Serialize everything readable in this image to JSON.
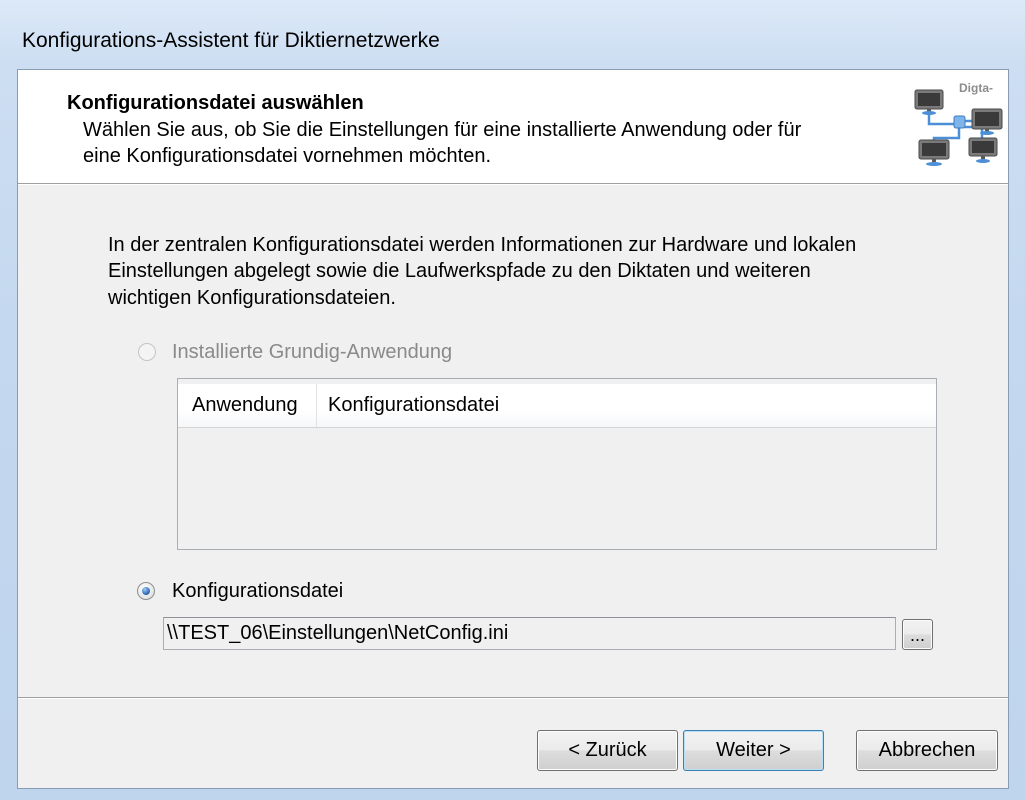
{
  "window": {
    "title": "Konfigurations-Assistent für Diktiernetzwerke"
  },
  "header": {
    "title": "Konfigurationsdatei auswählen",
    "subtitle_lines": [
      "Wählen Sie aus, ob Sie die Einstellungen für eine installierte Anwendung oder für",
      "eine Konfigurationsdatei vornehmen möchten."
    ],
    "logo_text": "Digta-",
    "logo_icon": "network-computers-icon"
  },
  "body": {
    "description_lines": [
      "In der zentralen Konfigurationsdatei werden Informationen zur Hardware und lokalen",
      "Einstellungen abgelegt sowie die Laufwerkspfade zu den Diktaten und weiteren",
      "wichtigen Konfigurationsdateien."
    ]
  },
  "options": {
    "installed_app": {
      "label": "Installierte Grundig-Anwendung",
      "selected": false,
      "enabled": false
    },
    "config_file": {
      "label": "Konfigurationsdatei",
      "selected": true,
      "enabled": true
    }
  },
  "app_list": {
    "columns": [
      "Anwendung",
      "Konfigurationsdatei"
    ],
    "rows": []
  },
  "config_path": {
    "value": "\\\\TEST_06\\Einstellungen\\NetConfig.ini",
    "browse_label": "..."
  },
  "buttons": {
    "back": "< Zurück",
    "next": "Weiter >",
    "cancel": "Abbrechen"
  },
  "colors": {
    "frame": "#c8dcf2",
    "dialog_background": "#f0f0f0",
    "header_background": "#ffffff",
    "disabled_text": "#8a8a8a",
    "radio_selected": "#1f5ba8"
  }
}
